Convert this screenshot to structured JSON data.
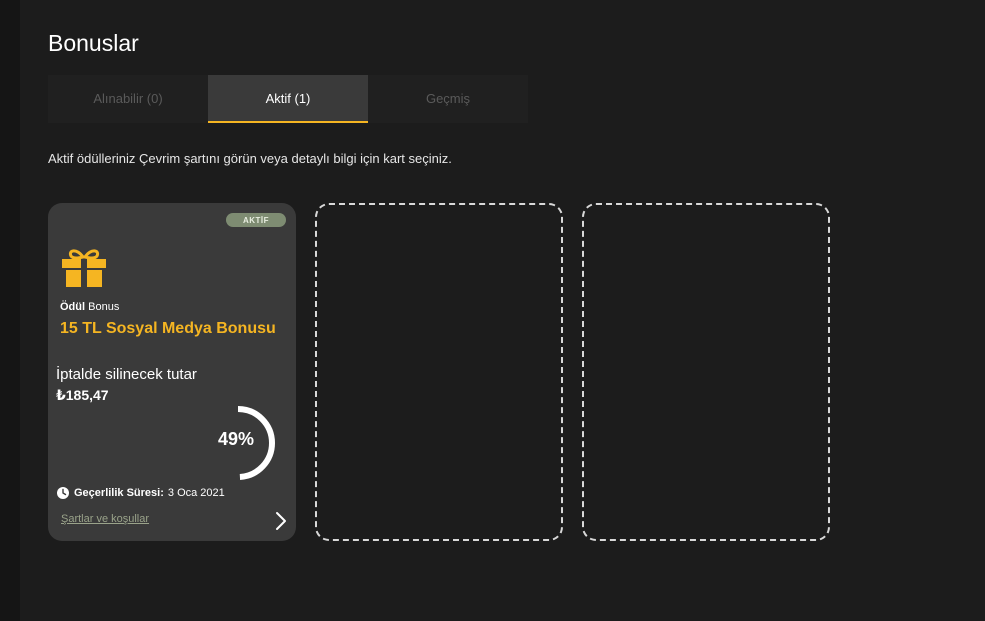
{
  "page": {
    "title": "Bonuslar"
  },
  "tabs": [
    {
      "label": "Alınabilir (0)",
      "active": false
    },
    {
      "label": "Aktif (1)",
      "active": true
    },
    {
      "label": "Geçmiş",
      "active": false
    }
  ],
  "info_text": "Aktif ödülleriniz Çevrim şartını görün veya detaylı bilgi için kart seçiniz.",
  "card": {
    "badge": "AKTİF",
    "reward_label": "Ödül",
    "reward_type": "Bonus",
    "title": "15 TL Sosyal Medya Bonusu",
    "cancel_label": "İptalde silinecek tutar",
    "cancel_amount": "₺185,47",
    "progress_text": "49%",
    "progress_value": 0.49,
    "validity_label": "Geçerlilik Süresi:",
    "validity_date": "3 Oca 2021",
    "terms_link": "Şartlar ve koşullar"
  },
  "colors": {
    "accent": "#f5b522",
    "badge": "#7e8c72",
    "card_bg": "#3a3a3a",
    "page_bg": "#1c1c1c"
  },
  "icons": {
    "gift": "gift-icon",
    "clock": "clock-icon",
    "chevron": "chevron-right-icon"
  },
  "empty_slots": 2
}
